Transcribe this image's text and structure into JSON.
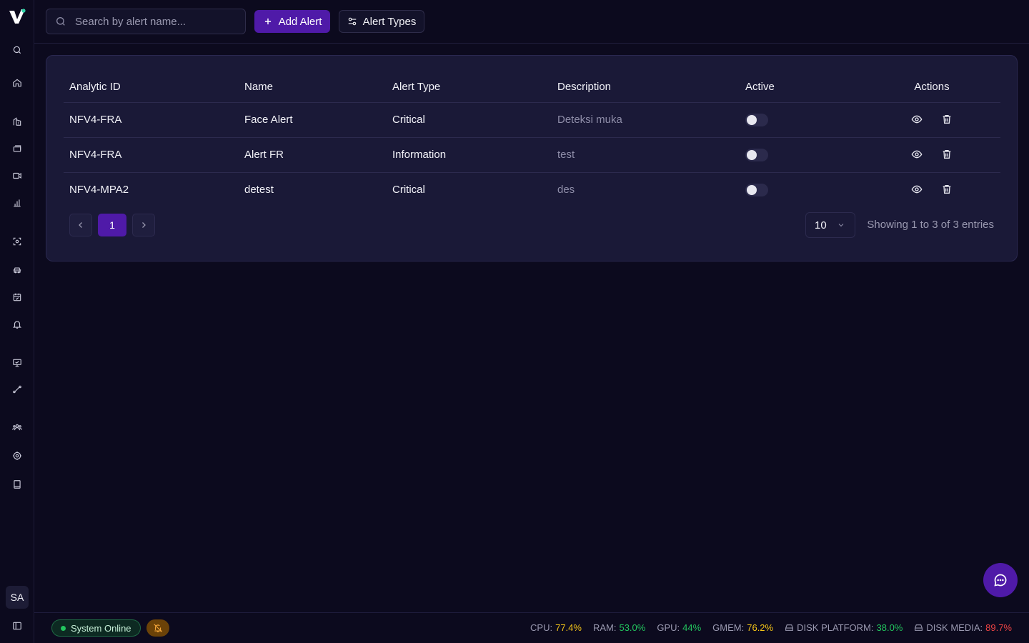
{
  "search": {
    "placeholder": "Search by alert name..."
  },
  "toolbar": {
    "add_label": "Add Alert",
    "types_label": "Alert Types"
  },
  "table": {
    "columns": [
      "Analytic ID",
      "Name",
      "Alert Type",
      "Description",
      "Active",
      "Actions"
    ],
    "rows": [
      {
        "analytic_id": "NFV4-FRA",
        "name": "Face Alert",
        "alert_type": "Critical",
        "description": "Deteksi muka",
        "active": false
      },
      {
        "analytic_id": "NFV4-FRA",
        "name": "Alert FR",
        "alert_type": "Information",
        "description": "test",
        "active": false
      },
      {
        "analytic_id": "NFV4-MPA2",
        "name": "detest",
        "alert_type": "Critical",
        "description": "des",
        "active": false
      }
    ]
  },
  "pagination": {
    "current_page": "1",
    "per_page": "10",
    "entries_text": "Showing 1 to 3 of 3 entries"
  },
  "user": {
    "initials": "SA"
  },
  "status": {
    "system": "System Online",
    "metrics": [
      {
        "label": "CPU:",
        "value": "77.4%",
        "color": "#f5c518"
      },
      {
        "label": "RAM:",
        "value": "53.0%",
        "color": "#22c55e"
      },
      {
        "label": "GPU:",
        "value": "44%",
        "color": "#22c55e"
      },
      {
        "label": "GMEM:",
        "value": "76.2%",
        "color": "#f5c518"
      },
      {
        "label": "DISK PLATFORM:",
        "value": "38.0%",
        "color": "#22c55e"
      },
      {
        "label": "DISK MEDIA:",
        "value": "89.7%",
        "color": "#ef4444"
      }
    ]
  },
  "colors": {
    "accent": "#4f1aa8",
    "background": "#0c0a1e",
    "card": "#1a1937"
  }
}
